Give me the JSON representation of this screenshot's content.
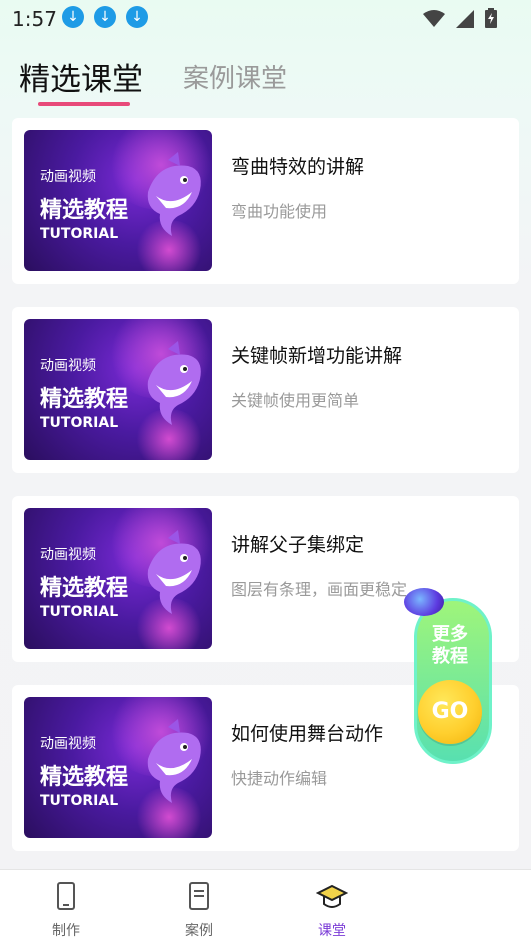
{
  "status_bar": {
    "time": "1:57",
    "download_indicators": [
      "download-icon",
      "download-icon",
      "download-icon"
    ]
  },
  "tabs": [
    {
      "label": "精选课堂",
      "active": true
    },
    {
      "label": "案例课堂",
      "active": false
    }
  ],
  "thumbnail": {
    "line1": "动画视频",
    "line2": "精选教程",
    "line3": "TUTORIAL"
  },
  "courses": [
    {
      "title": "弯曲特效的讲解",
      "subtitle": "弯曲功能使用"
    },
    {
      "title": "关键帧新增功能讲解",
      "subtitle": "关键帧使用更简单"
    },
    {
      "title": "讲解父子集绑定",
      "subtitle": "图层有条理，画面更稳定"
    },
    {
      "title": "如何使用舞台动作",
      "subtitle": "快捷动作编辑"
    }
  ],
  "promo": {
    "line1": "更多",
    "line2": "教程",
    "go": "GO"
  },
  "bottom_nav": [
    {
      "label": "制作",
      "icon": "phone-icon",
      "active": false
    },
    {
      "label": "案例",
      "icon": "document-icon",
      "active": false
    },
    {
      "label": "课堂",
      "icon": "graduation-cap-icon",
      "active": true
    }
  ],
  "colors": {
    "accent": "#e84a7a",
    "active_nav": "#7a3ad6",
    "download_badge": "#1e9be6"
  }
}
